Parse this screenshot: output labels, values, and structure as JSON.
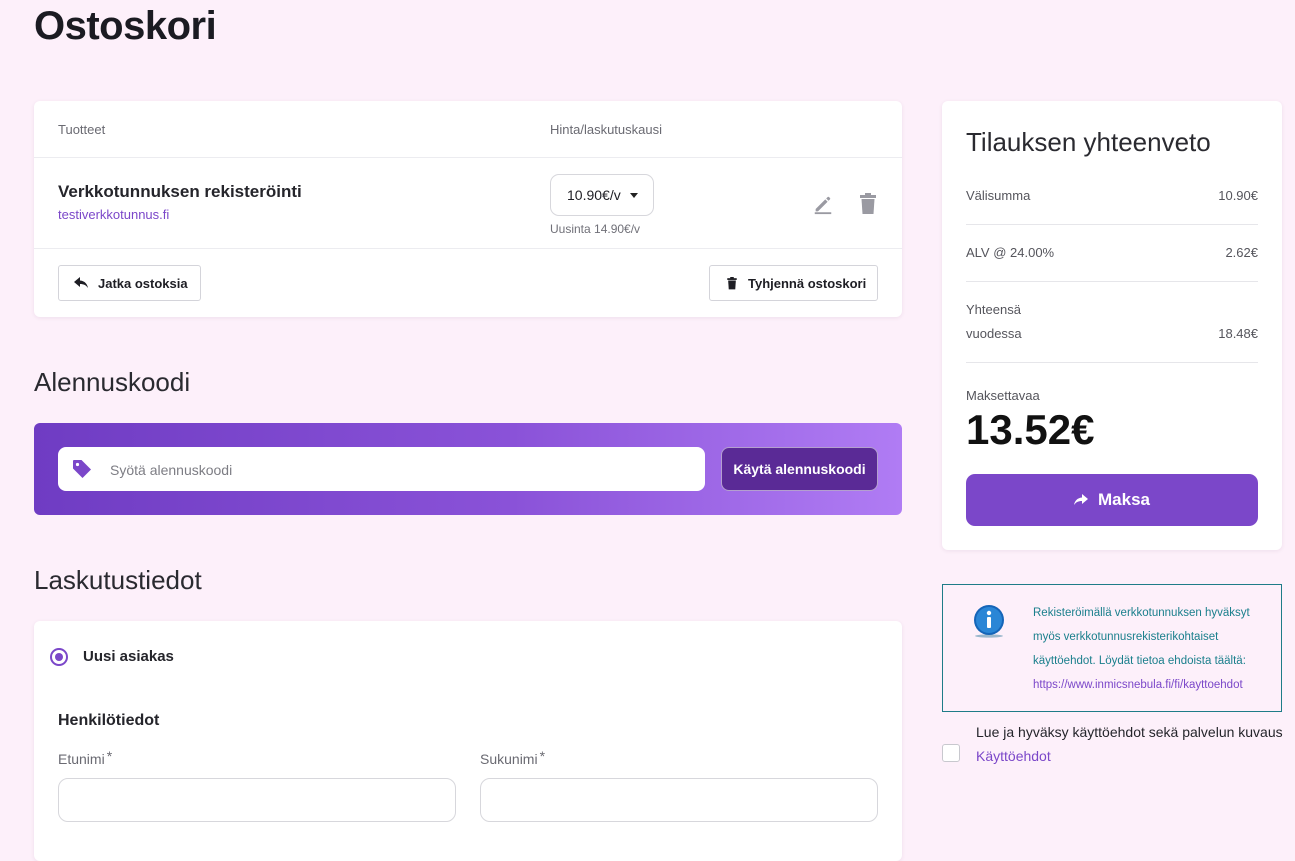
{
  "page": {
    "title": "Ostoskori"
  },
  "cart": {
    "headers": {
      "products": "Tuotteet",
      "price_period": "Hinta/laskutuskausi"
    },
    "item": {
      "name": "Verkkotunnuksen rekisteröinti",
      "domain": "testiverkkotunnus.fi",
      "price_selected": "10.90€/v",
      "renewal_note": "Uusinta 14.90€/v"
    },
    "continue_label": "Jatka ostoksia",
    "clear_label": "Tyhjennä ostoskori"
  },
  "discount": {
    "title": "Alennuskoodi",
    "placeholder": "Syötä alennuskoodi",
    "apply_label": "Käytä alennuskoodi"
  },
  "billing": {
    "title": "Laskutustiedot",
    "customer_option": "Uusi asiakas",
    "personal_heading": "Henkilötiedot",
    "first_name_label": "Etunimi",
    "last_name_label": "Sukunimi",
    "required_mark": "*"
  },
  "summary": {
    "title": "Tilauksen yhteenveto",
    "subtotal_label": "Välisumma",
    "subtotal_value": "10.90€",
    "vat_label": "ALV @ 24.00%",
    "vat_value": "2.62€",
    "total_label_line1": "Yhteensä",
    "total_label_line2": "vuodessa",
    "total_value": "18.48€",
    "due_label": "Maksettavaa",
    "due_amount": "13.52€",
    "pay_label": "Maksa"
  },
  "info": {
    "text": "Rekisteröimällä verkkotunnuksen hyväksyt myös verkkotunnusrekisterikohtaiset käyttöehdot. Löydät tietoa ehdoista täältä:",
    "link": "https://www.inmicsnebula.fi/fi/kayttoehdot"
  },
  "terms": {
    "text": "Lue ja hyväksy käyttöehdot sekä palvelun kuvaus",
    "link_label": "Käyttöehdot"
  },
  "colors": {
    "accent": "#7b47c9",
    "background": "#fdf0fa",
    "info_border": "#1e7c88",
    "info_text": "#1a7f8c"
  },
  "icons": [
    "edit-icon",
    "trash-icon",
    "reply-arrow-icon",
    "tag-icon",
    "share-arrow-icon",
    "info-icon"
  ]
}
